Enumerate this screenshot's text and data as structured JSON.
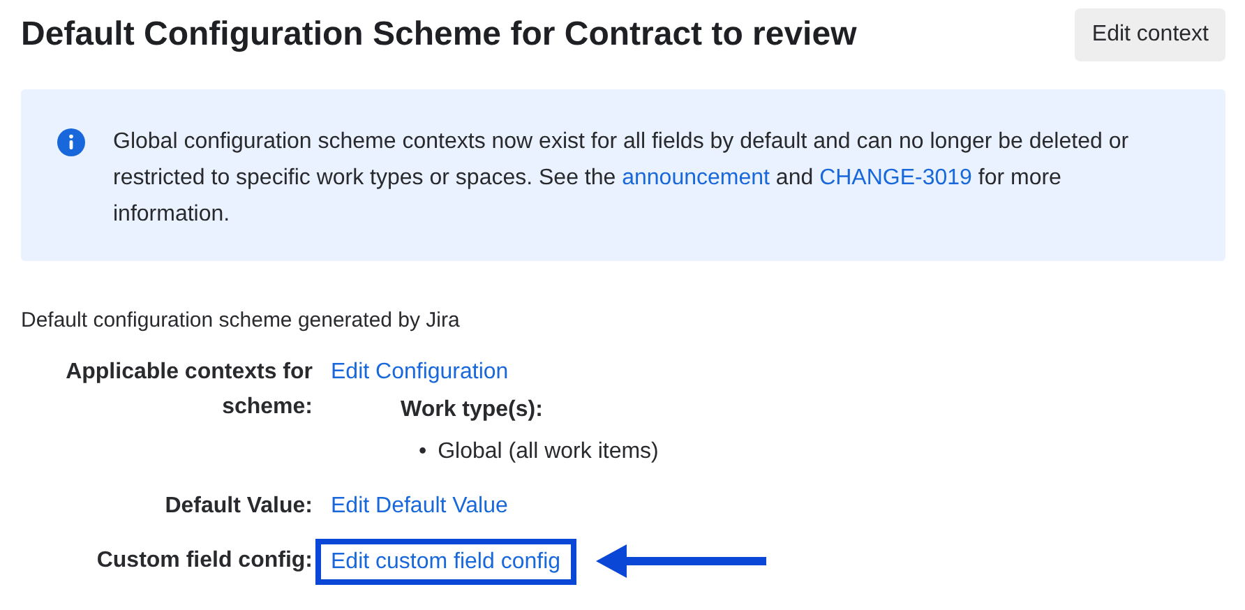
{
  "page_title": "Default Configuration Scheme for Contract to review",
  "edit_context_button": "Edit context",
  "banner": {
    "parts": [
      {
        "kind": "text",
        "text": "Global configuration scheme contexts now exist for all fields by default and can no longer be deleted or restricted to specific work types or spaces. See the "
      },
      {
        "kind": "link",
        "text": "announcement"
      },
      {
        "kind": "text",
        "text": " and "
      },
      {
        "kind": "link",
        "text": "CHANGE-3019"
      },
      {
        "kind": "text",
        "text": " for more information."
      }
    ]
  },
  "description": "Default configuration scheme generated by Jira",
  "rows": [
    {
      "label": "Applicable contexts for scheme:",
      "link": "Edit Configuration",
      "highlighted": false,
      "details": {
        "heading": "Work type(s):",
        "items": [
          {
            "bullet": "•",
            "text": "Global (all work items)"
          }
        ]
      }
    },
    {
      "label": "Default Value:",
      "link": "Edit Default Value",
      "highlighted": false
    },
    {
      "label": "Custom field config:",
      "link": "Edit custom field config",
      "highlighted": true
    }
  ]
}
